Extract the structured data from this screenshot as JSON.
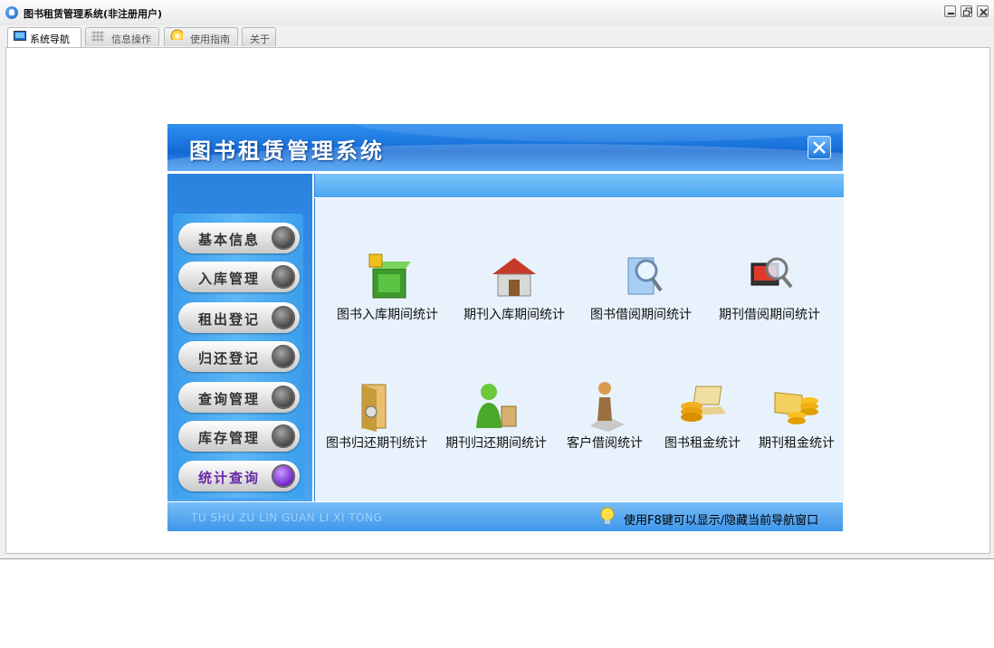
{
  "window": {
    "title": "图书租赁管理系统(非注册用户)"
  },
  "tabs": [
    {
      "label": "系统导航",
      "active": true
    },
    {
      "label": "信息操作",
      "active": false
    },
    {
      "label": "使用指南",
      "active": false
    },
    {
      "label": "关于",
      "active": false
    }
  ],
  "panel": {
    "title": "图书租赁管理系统"
  },
  "sidebar": {
    "items": [
      {
        "label": "基本信息"
      },
      {
        "label": "入库管理"
      },
      {
        "label": "租出登记"
      },
      {
        "label": "归还登记"
      },
      {
        "label": "查询管理"
      },
      {
        "label": "库存管理"
      },
      {
        "label": "统计查询",
        "active": true
      }
    ]
  },
  "stats": {
    "row1": [
      {
        "label": "图书入库期间统计",
        "icon": "green-box-icon"
      },
      {
        "label": "期刊入库期间统计",
        "icon": "house-icon"
      },
      {
        "label": "图书借阅期间统计",
        "icon": "magnifier-document-icon"
      },
      {
        "label": "期刊借阅期间统计",
        "icon": "monitor-magnifier-icon"
      }
    ],
    "row2": [
      {
        "label": "图书归还期刊统计",
        "icon": "door-exit-icon"
      },
      {
        "label": "期刊归还期间统计",
        "icon": "person-shopping-icon"
      },
      {
        "label": "客户借阅统计",
        "icon": "person-icon"
      },
      {
        "label": "图书租金统计",
        "icon": "laptop-coins-icon"
      },
      {
        "label": "期刊租金统计",
        "icon": "coin-stacks-icon"
      }
    ]
  },
  "footer": {
    "pinyin": "TU SHU ZU LIN  GUAN LI XI TONG",
    "tip": "使用F8键可以显示/隐藏当前导航窗口"
  },
  "colors": {
    "banner": "#1a74dc",
    "main_bg": "#e8f2fc",
    "active_item": "#6a2aa8"
  }
}
